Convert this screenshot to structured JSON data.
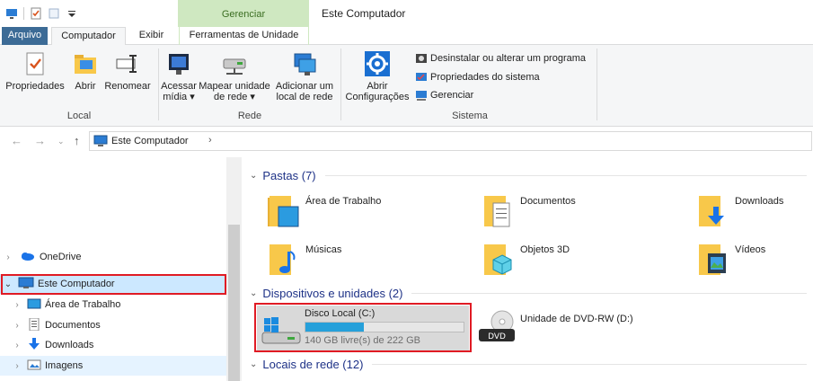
{
  "window": {
    "title": "Este Computador",
    "context_tab_header": "Gerenciar"
  },
  "tabs": [
    "Arquivo",
    "Computador",
    "Exibir",
    "Ferramentas de Unidade"
  ],
  "ribbon": {
    "local": {
      "label": "Local",
      "buttons": [
        "Propriedades",
        "Abrir",
        "Renomear"
      ]
    },
    "rede": {
      "label": "Rede",
      "buttons": [
        {
          "line1": "Acessar",
          "line2": "mídia ▾"
        },
        {
          "line1": "Mapear unidade",
          "line2": "de rede ▾"
        },
        {
          "line1": "Adicionar um",
          "line2": "local de rede"
        }
      ]
    },
    "sistema": {
      "label": "Sistema",
      "big": {
        "line1": "Abrir",
        "line2": "Configurações"
      },
      "small": [
        "Desinstalar ou alterar um programa",
        "Propriedades do sistema",
        "Gerenciar"
      ]
    }
  },
  "address": {
    "path": "Este Computador"
  },
  "nav": {
    "items": [
      "OneDrive",
      "Este Computador",
      "Área de Trabalho",
      "Documentos",
      "Downloads",
      "Imagens"
    ]
  },
  "content": {
    "pastas": {
      "header": "Pastas (7)",
      "items": [
        "Área de Trabalho",
        "Documentos",
        "Downloads",
        "Músicas",
        "Objetos 3D",
        "Vídeos"
      ]
    },
    "dispositivos": {
      "header": "Dispositivos e unidades (2)",
      "disk": {
        "name": "Disco Local (C:)",
        "free": "140 GB livre(s) de 222 GB",
        "used_fraction": 0.37
      },
      "dvd": {
        "name": "Unidade de DVD-RW (D:)",
        "badge": "DVD"
      }
    },
    "locais": {
      "header": "Locais de rede (12)"
    }
  },
  "colors": {
    "accent": "#26a0da",
    "highlight": "#cce8ff",
    "selection_box": "#e01b24",
    "context_green": "#cfe8c1",
    "file_tab": "#3c6b96"
  }
}
